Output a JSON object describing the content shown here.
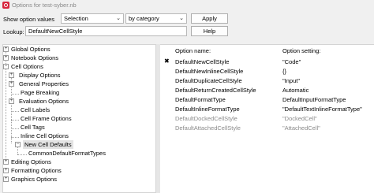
{
  "window": {
    "title": "Options for test-syber.nb"
  },
  "controls": {
    "show_label": "Show option values",
    "show_value": "Selection",
    "category_value": "by category",
    "apply_label": "Apply",
    "lookup_label": "Lookup:",
    "lookup_value": "DefaultNewCellStyle",
    "help_label": "Help"
  },
  "tree": {
    "global": "Global Options",
    "notebook": "Notebook Options",
    "cell": "Cell Options",
    "display": "Display Options",
    "general": "General Properties",
    "page_breaking": "Page Breaking",
    "evaluation": "Evaluation Options",
    "cell_labels": "Cell Labels",
    "cell_frame": "Cell Frame Options",
    "cell_tags": "Cell Tags",
    "inline_cell": "Inline Cell Options",
    "new_cell_defaults": "New Cell Defaults",
    "common_default": "CommonDefaultFormatTypes",
    "editing": "Editing Options",
    "formatting": "Formatting Options",
    "graphics": "Graphics Options"
  },
  "table": {
    "header_name": "Option name:",
    "header_setting": "Option setting:",
    "rows": [
      {
        "name": "DefaultNewCellStyle",
        "value": "\"Code\"",
        "icon": "✖"
      },
      {
        "name": "DefaultNewInlineCellStyle",
        "value": "{}"
      },
      {
        "name": "DefaultDuplicateCellStyle",
        "value": "\"Input\""
      },
      {
        "name": "DefaultReturnCreatedCellStyle",
        "value": "Automatic"
      },
      {
        "name": "DefaultFormatType",
        "value": "DefaultInputFormatType"
      },
      {
        "name": "DefaultInlineFormatType",
        "value": "\"DefaultTextInlineFormatType\""
      },
      {
        "name": "DefaultDockedCellStyle",
        "value": "\"DockedCell\""
      },
      {
        "name": "DefaultAttachedCellStyle",
        "value": "\"AttachedCell\""
      }
    ]
  }
}
